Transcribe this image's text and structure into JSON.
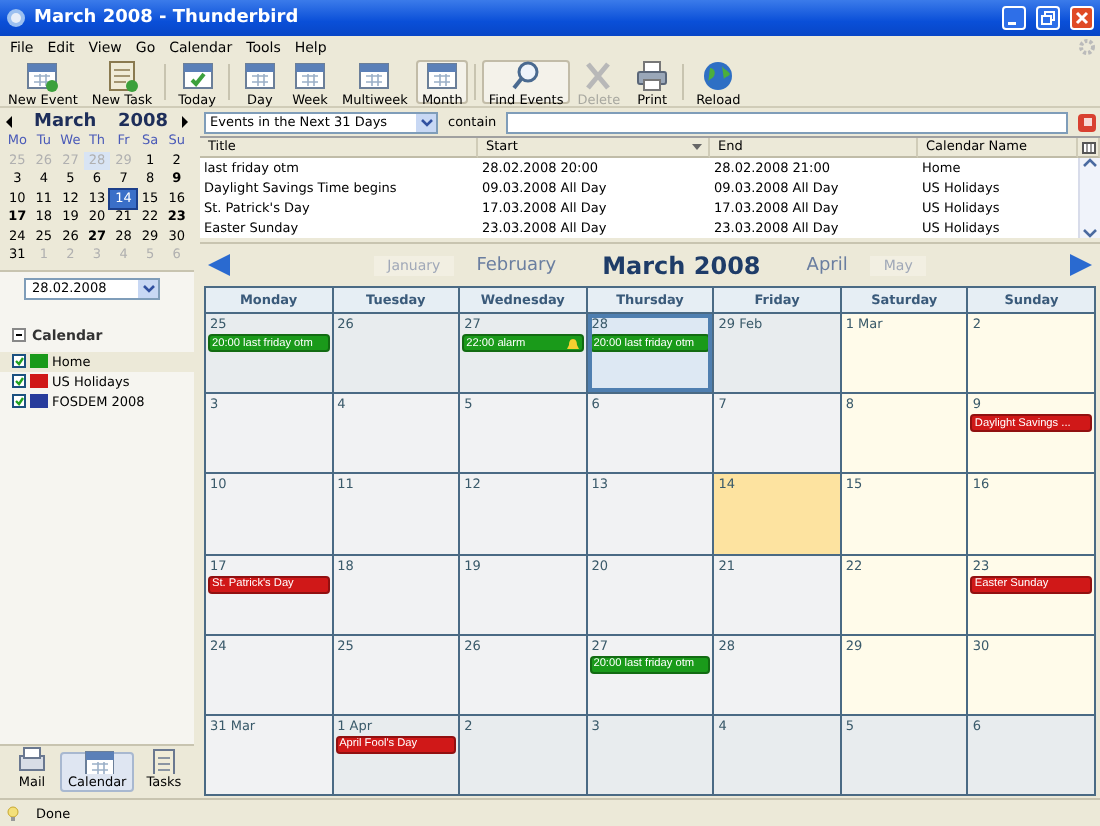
{
  "window": {
    "title": "March 2008 - Thunderbird"
  },
  "menu": [
    "File",
    "Edit",
    "View",
    "Go",
    "Calendar",
    "Tools",
    "Help"
  ],
  "toolbar": [
    {
      "label": "New Event",
      "pressed": false,
      "disabled": false
    },
    {
      "label": "New Task",
      "pressed": false,
      "disabled": false
    },
    {
      "label": "Today",
      "pressed": false,
      "disabled": false
    },
    {
      "label": "Day",
      "pressed": false,
      "disabled": false
    },
    {
      "label": "Week",
      "pressed": false,
      "disabled": false
    },
    {
      "label": "Multiweek",
      "pressed": false,
      "disabled": false
    },
    {
      "label": "Month",
      "pressed": true,
      "disabled": false
    },
    {
      "label": "Find Events",
      "pressed": true,
      "disabled": false
    },
    {
      "label": "Delete",
      "pressed": false,
      "disabled": true
    },
    {
      "label": "Print",
      "pressed": false,
      "disabled": false
    },
    {
      "label": "Reload",
      "pressed": false,
      "disabled": false
    }
  ],
  "minimonth": {
    "month": "March",
    "year": "2008",
    "weekdays": [
      "Mo",
      "Tu",
      "We",
      "Th",
      "Fr",
      "Sa",
      "Su"
    ],
    "days": [
      {
        "label": "25",
        "dim": true,
        "bold": false,
        "today": false,
        "selected": false
      },
      {
        "label": "26",
        "dim": true,
        "bold": false,
        "today": false,
        "selected": false
      },
      {
        "label": "27",
        "dim": true,
        "bold": false,
        "today": false,
        "selected": false
      },
      {
        "label": "28",
        "dim": true,
        "bold": false,
        "today": false,
        "selected": true
      },
      {
        "label": "29",
        "dim": true,
        "bold": false,
        "today": false,
        "selected": false
      },
      {
        "label": "1",
        "dim": false,
        "bold": false,
        "today": false,
        "selected": false
      },
      {
        "label": "2",
        "dim": false,
        "bold": false,
        "today": false,
        "selected": false
      },
      {
        "label": "3",
        "dim": false,
        "bold": false,
        "today": false,
        "selected": false
      },
      {
        "label": "4",
        "dim": false,
        "bold": false,
        "today": false,
        "selected": false
      },
      {
        "label": "5",
        "dim": false,
        "bold": false,
        "today": false,
        "selected": false
      },
      {
        "label": "6",
        "dim": false,
        "bold": false,
        "today": false,
        "selected": false
      },
      {
        "label": "7",
        "dim": false,
        "bold": false,
        "today": false,
        "selected": false
      },
      {
        "label": "8",
        "dim": false,
        "bold": false,
        "today": false,
        "selected": false
      },
      {
        "label": "9",
        "dim": false,
        "bold": true,
        "today": false,
        "selected": false
      },
      {
        "label": "10",
        "dim": false,
        "bold": false,
        "today": false,
        "selected": false
      },
      {
        "label": "11",
        "dim": false,
        "bold": false,
        "today": false,
        "selected": false
      },
      {
        "label": "12",
        "dim": false,
        "bold": false,
        "today": false,
        "selected": false
      },
      {
        "label": "13",
        "dim": false,
        "bold": false,
        "today": false,
        "selected": false
      },
      {
        "label": "14",
        "dim": false,
        "bold": false,
        "today": true,
        "selected": false
      },
      {
        "label": "15",
        "dim": false,
        "bold": false,
        "today": false,
        "selected": false
      },
      {
        "label": "16",
        "dim": false,
        "bold": false,
        "today": false,
        "selected": false
      },
      {
        "label": "17",
        "dim": false,
        "bold": true,
        "today": false,
        "selected": false
      },
      {
        "label": "18",
        "dim": false,
        "bold": false,
        "today": false,
        "selected": false
      },
      {
        "label": "19",
        "dim": false,
        "bold": false,
        "today": false,
        "selected": false
      },
      {
        "label": "20",
        "dim": false,
        "bold": false,
        "today": false,
        "selected": false
      },
      {
        "label": "21",
        "dim": false,
        "bold": false,
        "today": false,
        "selected": false
      },
      {
        "label": "22",
        "dim": false,
        "bold": false,
        "today": false,
        "selected": false
      },
      {
        "label": "23",
        "dim": false,
        "bold": true,
        "today": false,
        "selected": false
      },
      {
        "label": "24",
        "dim": false,
        "bold": false,
        "today": false,
        "selected": false
      },
      {
        "label": "25",
        "dim": false,
        "bold": false,
        "today": false,
        "selected": false
      },
      {
        "label": "26",
        "dim": false,
        "bold": false,
        "today": false,
        "selected": false
      },
      {
        "label": "27",
        "dim": false,
        "bold": true,
        "today": false,
        "selected": false
      },
      {
        "label": "28",
        "dim": false,
        "bold": false,
        "today": false,
        "selected": false
      },
      {
        "label": "29",
        "dim": false,
        "bold": false,
        "today": false,
        "selected": false
      },
      {
        "label": "30",
        "dim": false,
        "bold": false,
        "today": false,
        "selected": false
      },
      {
        "label": "31",
        "dim": false,
        "bold": false,
        "today": false,
        "selected": false
      },
      {
        "label": "1",
        "dim": true,
        "bold": false,
        "today": false,
        "selected": false
      },
      {
        "label": "2",
        "dim": true,
        "bold": false,
        "today": false,
        "selected": false
      },
      {
        "label": "3",
        "dim": true,
        "bold": false,
        "today": false,
        "selected": false
      },
      {
        "label": "4",
        "dim": true,
        "bold": false,
        "today": false,
        "selected": false
      },
      {
        "label": "5",
        "dim": true,
        "bold": false,
        "today": false,
        "selected": false
      },
      {
        "label": "6",
        "dim": true,
        "bold": false,
        "today": false,
        "selected": false
      }
    ]
  },
  "date_field": {
    "value": "28.02.2008"
  },
  "calendars": {
    "title": "Calendar",
    "expanded": true,
    "items": [
      {
        "name": "Home",
        "color": "#1a9a1a",
        "checked": true,
        "selected": true
      },
      {
        "name": "US Holidays",
        "color": "#d01818",
        "checked": true,
        "selected": false
      },
      {
        "name": "FOSDEM 2008",
        "color": "#283c9c",
        "checked": true,
        "selected": false
      }
    ]
  },
  "modes": [
    {
      "label": "Mail",
      "selected": false
    },
    {
      "label": "Calendar",
      "selected": true
    },
    {
      "label": "Tasks",
      "selected": false
    }
  ],
  "filter": {
    "range": "Events in the Next 31 Days",
    "label": "contain"
  },
  "event_list": {
    "columns": [
      {
        "label": "Title",
        "sorted": false
      },
      {
        "label": "Start",
        "sorted": true
      },
      {
        "label": "End",
        "sorted": false
      },
      {
        "label": "Calendar Name",
        "sorted": false
      }
    ],
    "rows": [
      [
        "last friday otm",
        "28.02.2008 20:00",
        "28.02.2008 21:00",
        "Home"
      ],
      [
        "Daylight Savings Time begins",
        "09.03.2008 All Day",
        "09.03.2008 All Day",
        "US Holidays"
      ],
      [
        "St. Patrick's Day",
        "17.03.2008 All Day",
        "17.03.2008 All Day",
        "US Holidays"
      ],
      [
        "Easter Sunday",
        "23.03.2008 All Day",
        "23.03.2008 All Day",
        "US Holidays"
      ]
    ]
  },
  "month_nav": [
    {
      "label": "January",
      "kind": "far"
    },
    {
      "label": "February",
      "kind": "near"
    },
    {
      "label": "March 2008",
      "kind": "current"
    },
    {
      "label": "April",
      "kind": "near"
    },
    {
      "label": "May",
      "kind": "far"
    }
  ],
  "month_view": {
    "weekdays": [
      "Monday",
      "Tuesday",
      "Wednesday",
      "Thursday",
      "Friday",
      "Saturday",
      "Sunday"
    ],
    "cells": [
      {
        "label": "25",
        "kind": "other",
        "today": false,
        "selected": false,
        "events": [
          {
            "text": "20:00 last friday otm",
            "color": "#1a9a1a",
            "alarm": false
          }
        ]
      },
      {
        "label": "26",
        "kind": "other",
        "today": false,
        "selected": false
      },
      {
        "label": "27",
        "kind": "other",
        "today": false,
        "selected": false,
        "events": [
          {
            "text": "22:00 alarm",
            "color": "#1a9a1a",
            "alarm": true
          }
        ]
      },
      {
        "label": "28",
        "kind": "other",
        "today": false,
        "selected": true,
        "events": [
          {
            "text": "20:00 last friday otm",
            "color": "#1a9a1a",
            "alarm": false
          }
        ]
      },
      {
        "label": "29 Feb",
        "kind": "other",
        "today": false,
        "selected": false
      },
      {
        "label": "1 Mar",
        "kind": "weekend",
        "today": false,
        "selected": false
      },
      {
        "label": "2",
        "kind": "weekend",
        "today": false,
        "selected": false
      },
      {
        "label": "3",
        "kind": "weekday",
        "today": false,
        "selected": false
      },
      {
        "label": "4",
        "kind": "weekday",
        "today": false,
        "selected": false
      },
      {
        "label": "5",
        "kind": "weekday",
        "today": false,
        "selected": false
      },
      {
        "label": "6",
        "kind": "weekday",
        "today": false,
        "selected": false
      },
      {
        "label": "7",
        "kind": "weekday",
        "today": false,
        "selected": false
      },
      {
        "label": "8",
        "kind": "weekend",
        "today": false,
        "selected": false
      },
      {
        "label": "9",
        "kind": "weekend",
        "today": false,
        "selected": false,
        "events": [
          {
            "text": "Daylight Savings ...",
            "color": "#d01818",
            "alarm": false
          }
        ]
      },
      {
        "label": "10",
        "kind": "weekday",
        "today": false,
        "selected": false
      },
      {
        "label": "11",
        "kind": "weekday",
        "today": false,
        "selected": false
      },
      {
        "label": "12",
        "kind": "weekday",
        "today": false,
        "selected": false
      },
      {
        "label": "13",
        "kind": "weekday",
        "today": false,
        "selected": false
      },
      {
        "label": "14",
        "kind": "weekday",
        "today": true,
        "selected": false
      },
      {
        "label": "15",
        "kind": "weekend",
        "today": false,
        "selected": false
      },
      {
        "label": "16",
        "kind": "weekend",
        "today": false,
        "selected": false
      },
      {
        "label": "17",
        "kind": "weekday",
        "today": false,
        "selected": false,
        "events": [
          {
            "text": "St. Patrick's Day",
            "color": "#d01818",
            "alarm": false
          }
        ]
      },
      {
        "label": "18",
        "kind": "weekday",
        "today": false,
        "selected": false
      },
      {
        "label": "19",
        "kind": "weekday",
        "today": false,
        "selected": false
      },
      {
        "label": "20",
        "kind": "weekday",
        "today": false,
        "selected": false
      },
      {
        "label": "21",
        "kind": "weekday",
        "today": false,
        "selected": false
      },
      {
        "label": "22",
        "kind": "weekend",
        "today": false,
        "selected": false
      },
      {
        "label": "23",
        "kind": "weekend",
        "today": false,
        "selected": false,
        "events": [
          {
            "text": "Easter Sunday",
            "color": "#d01818",
            "alarm": false
          }
        ]
      },
      {
        "label": "24",
        "kind": "weekday",
        "today": false,
        "selected": false
      },
      {
        "label": "25",
        "kind": "weekday",
        "today": false,
        "selected": false
      },
      {
        "label": "26",
        "kind": "weekday",
        "today": false,
        "selected": false
      },
      {
        "label": "27",
        "kind": "weekday",
        "today": false,
        "selected": false,
        "events": [
          {
            "text": "20:00 last friday otm",
            "color": "#1a9a1a",
            "alarm": false
          }
        ]
      },
      {
        "label": "28",
        "kind": "weekday",
        "today": false,
        "selected": false
      },
      {
        "label": "29",
        "kind": "weekend",
        "today": false,
        "selected": false
      },
      {
        "label": "30",
        "kind": "weekend",
        "today": false,
        "selected": false
      },
      {
        "label": "31 Mar",
        "kind": "weekday",
        "today": false,
        "selected": false
      },
      {
        "label": "1 Apr",
        "kind": "other",
        "today": false,
        "selected": false,
        "events": [
          {
            "text": "April Fool's Day",
            "color": "#d01818",
            "alarm": false
          }
        ]
      },
      {
        "label": "2",
        "kind": "other",
        "today": false,
        "selected": false
      },
      {
        "label": "3",
        "kind": "other",
        "today": false,
        "selected": false
      },
      {
        "label": "4",
        "kind": "other",
        "today": false,
        "selected": false
      },
      {
        "label": "5",
        "kind": "other",
        "today": false,
        "selected": false
      },
      {
        "label": "6",
        "kind": "other",
        "today": false,
        "selected": false
      }
    ]
  },
  "status_bar": {
    "text": "Done"
  }
}
